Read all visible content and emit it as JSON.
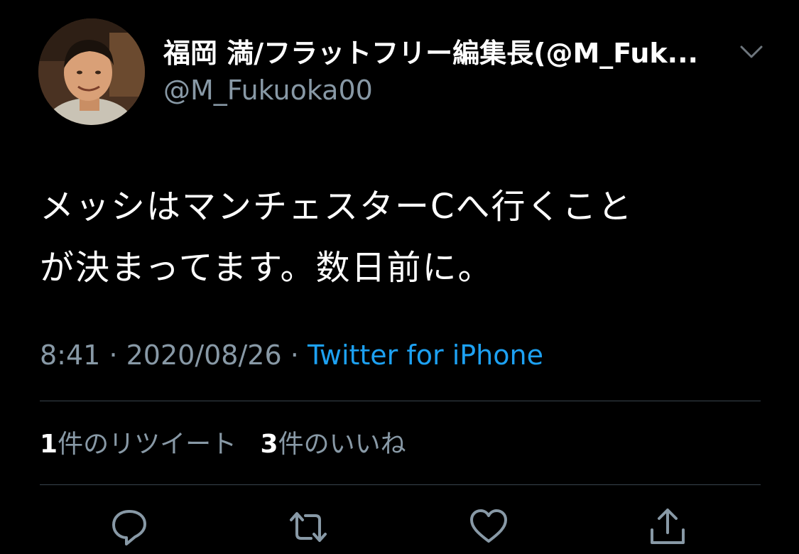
{
  "user": {
    "display_name": "福岡 満/フラットフリー編集長(@M_Fuk...",
    "handle": "@M_Fukuoka00",
    "avatar_icon": "profile-photo"
  },
  "tweet": {
    "lines": [
      "メッシはマンチェスターCへ行くこと",
      "が決まってます。数日前に。"
    ],
    "time": "8:41",
    "sep1": "·",
    "date": "2020/08/26",
    "sep2": "·",
    "source": "Twitter for iPhone"
  },
  "stats": {
    "retweets_count": "1",
    "retweets_label": "件のリツイート",
    "likes_count": "3",
    "likes_label": "件のいいね"
  },
  "actions": {
    "reply_icon": "reply-icon",
    "retweet_icon": "retweet-icon",
    "like_icon": "heart-icon",
    "share_icon": "share-icon"
  },
  "colors": {
    "background": "#000000",
    "text": "#ffffff",
    "secondary": "#8899a6",
    "link": "#1da1f2",
    "divider": "#38444d"
  }
}
